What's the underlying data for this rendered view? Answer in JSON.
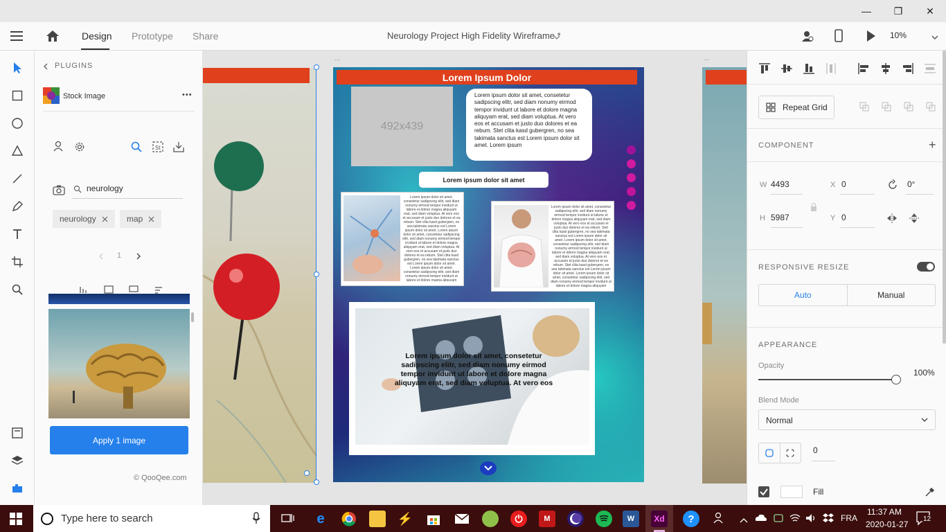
{
  "window": {
    "minimize": "—",
    "restore": "❐",
    "close": "✕"
  },
  "toolbar": {
    "tabs": [
      "Design",
      "Prototype",
      "Share"
    ],
    "document_title": "Neurology Project High Fidelity Wireframe *",
    "zoom": "10%"
  },
  "plugins": {
    "back_label": "PLUGINS",
    "plugin_name": "Stock Image",
    "more_label": "•••",
    "search_value": "neurology",
    "tags": [
      "neurology",
      "map"
    ],
    "page_number": "1",
    "apply_button": "Apply 1 image",
    "footer_logo": "QooQee.com"
  },
  "artboard": {
    "header": "Lorem Ipsum Dolor",
    "placeholder_image": "492x439",
    "top_paragraph": "Lorem ipsum dolor sit amet, consetetur sadipscing elitr, sed diam nonumy eirmod tempor invidunt ut labore et dolore magna aliquyam erat, sed diam voluptua. At vero eos et accusam et justo duo dolores et ea rebum. Stet clita kasd gubergren, no sea takimata sanctus est Lorem ipsum dolor sit amet. Lorem ipsum",
    "pill_text": "Lorem ipsum dolor sit amet",
    "card_text": "Lorem ipsum dolor sit amet, consetetur sadipscing elitr, sed diam nonumy eirmod tempor invidunt ut labore et dolore magna aliquyam erat, sed diam voluptua. At vero eos et accusam et justo duo dolores et ea rebum. Stet clita kasd gubergren, no sea takimata sanctus est Lorem ipsum dolor sit amet. Lorem ipsum dolor sit amet, consetetur sadipscing elitr, sed diam nonumy eirmod tempor invidunt ut labore et dolore magna aliquyam erat, sed diam voluptua. At vero eos et accusam et justo duo dolores et ea rebum. Stet clita kasd gubergren, no sea takimata sanctus est Lorem ipsum dolor sit amet. Lorem ipsum dolor sit amet, consetetur sadipscing elitr, sed diam nonumy eirmod tempor invidunt ut labore et dolore magna aliquyam",
    "overlay_text": "Lorem ipsum dolor sit amet, consetetur sadipscing elitr, sed diam nonumy eirmod tempor invidunt ut labore et dolore magna aliquyam erat, sed diam voluptua. At vero eos",
    "dots_colors": [
      "#a0129a",
      "#d01aa0",
      "#d01aa0",
      "#c0149a",
      "#d01aa0"
    ]
  },
  "properties": {
    "repeat_grid": "Repeat Grid",
    "component_label": "COMPONENT",
    "w_label": "W",
    "w_value": "4493",
    "h_label": "H",
    "h_value": "5987",
    "x_label": "X",
    "x_value": "0",
    "y_label": "Y",
    "y_value": "0",
    "rotation_value": "0°",
    "responsive_label": "RESPONSIVE RESIZE",
    "auto_label": "Auto",
    "manual_label": "Manual",
    "appearance_label": "APPEARANCE",
    "opacity_label": "Opacity",
    "opacity_value": "100%",
    "blend_label": "Blend Mode",
    "blend_value": "Normal",
    "radius_value": "0",
    "fill_label": "Fill"
  },
  "taskbar": {
    "search_placeholder": "Type here to search",
    "language": "FRA",
    "time": "11:37 AM",
    "date": "2020-01-27",
    "notifications": "12"
  },
  "colors": {
    "accent_blue": "#2680eb",
    "header_red": "#e0401c",
    "taskbar": "#3b0d0d"
  }
}
